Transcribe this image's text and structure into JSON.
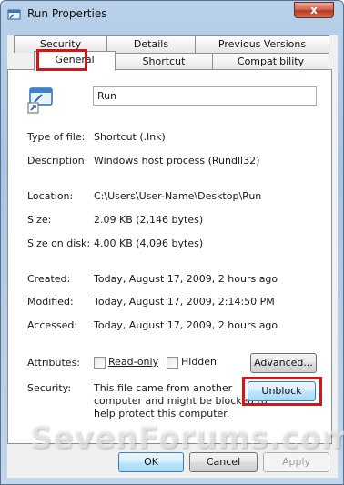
{
  "window": {
    "title": "Run Properties",
    "close_glyph": "x",
    "close_color": "#c4472b"
  },
  "tabs": {
    "row_back": [
      "Security",
      "Details",
      "Previous Versions"
    ],
    "row_front": [
      "General",
      "Shortcut",
      "Compatibility"
    ],
    "active": "General"
  },
  "general": {
    "name": "Run",
    "type_label": "Type of file:",
    "type_value": "Shortcut (.lnk)",
    "desc_label": "Description:",
    "desc_value": "Windows host process (Rundll32)",
    "location_label": "Location:",
    "location_value": "C:\\Users\\User-Name\\Desktop\\Run",
    "size_label": "Size:",
    "size_value": "2.09 KB (2,146 bytes)",
    "size_disk_label": "Size on disk:",
    "size_disk_value": "4.00 KB (4,096 bytes)",
    "created_label": "Created:",
    "created_value": "Today, August 17, 2009, 2 hours ago",
    "modified_label": "Modified:",
    "modified_value": "Today, August 17, 2009, 2:14:50 PM",
    "accessed_label": "Accessed:",
    "accessed_value": "Today, August 17, 2009, 2 hours ago",
    "attributes_label": "Attributes:",
    "readonly_label": "Read-only",
    "hidden_label": "Hidden",
    "advanced_label": "Advanced...",
    "security_label": "Security:",
    "security_text_1": "This file came from another",
    "security_text_2": "computer and might be blocked to",
    "security_text_3": "help protect this computer.",
    "unblock_label": "Unblock"
  },
  "buttons": {
    "ok": "OK",
    "cancel": "Cancel",
    "apply": "Apply"
  },
  "watermark": "SevenForums.com",
  "highlight_color": "#d01818"
}
